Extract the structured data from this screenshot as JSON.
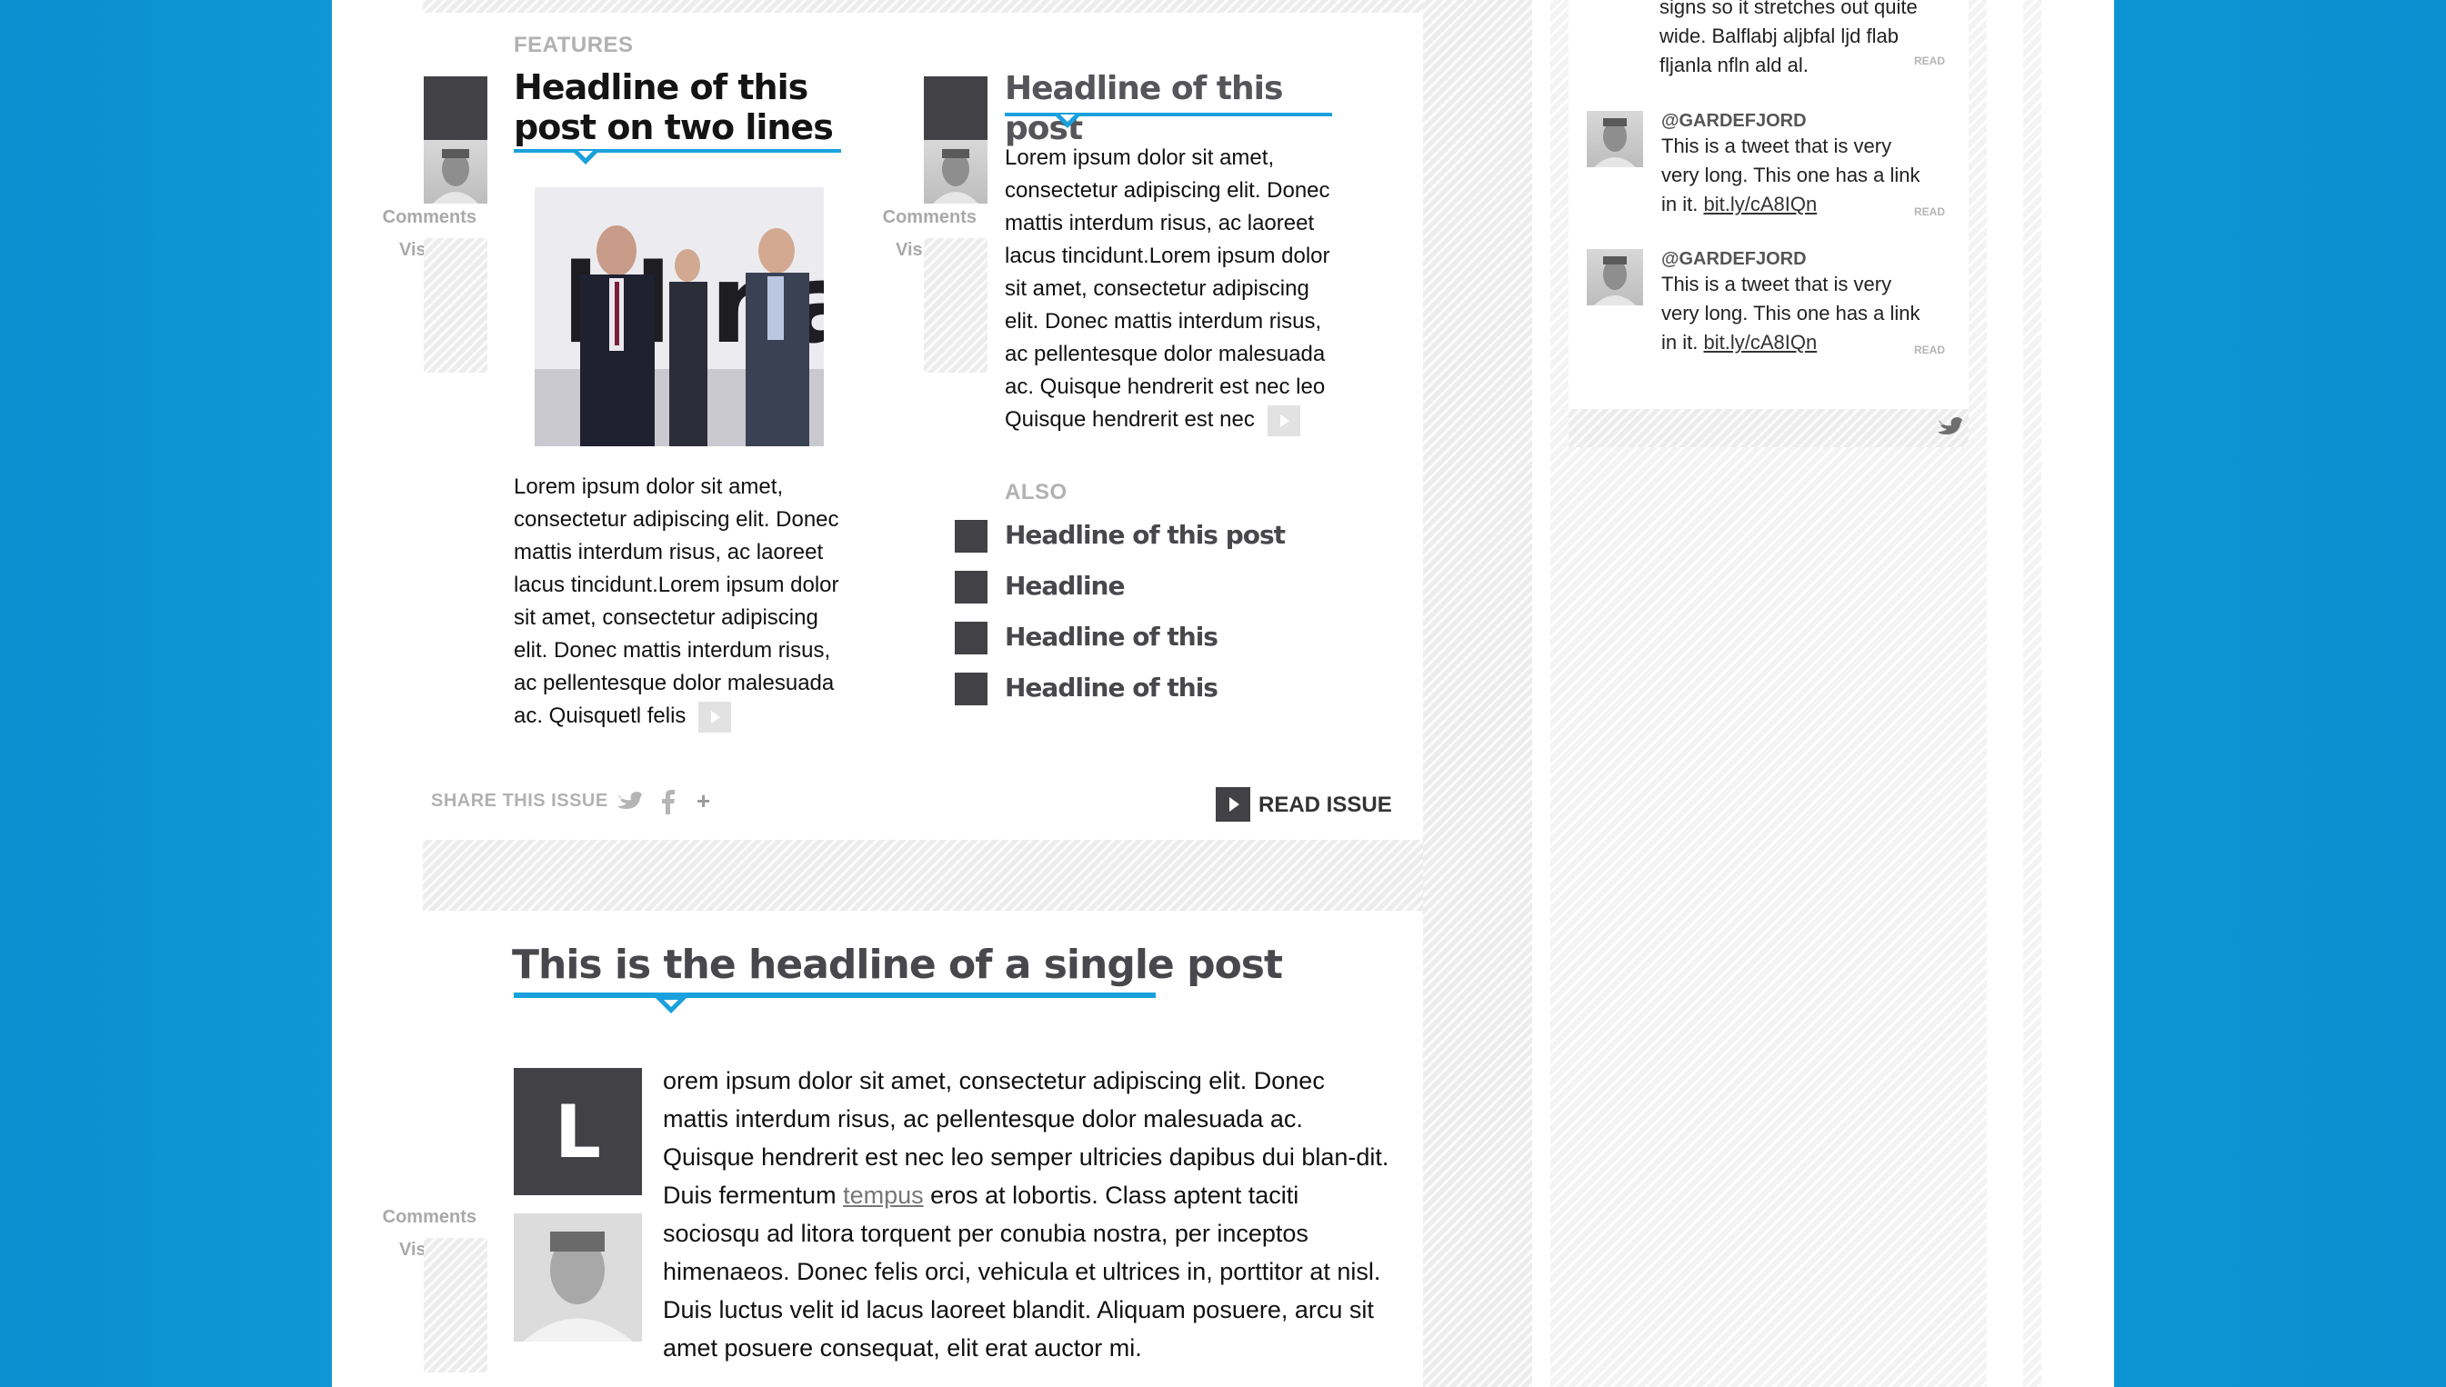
{
  "features": {
    "section_label": "FEATURES",
    "post1": {
      "headline": "Headline of this post on two lines",
      "meta_comments": "Comments",
      "meta_visits": "Visits",
      "body": "Lorem ipsum dolor sit amet, consectetur adipiscing elit. Donec mattis interdum risus, ac laoreet lacus tincidunt.Lorem ipsum dolor sit amet, consectetur adipiscing elit. Donec mattis interdum risus, ac pellentesque dolor malesuada ac. Quisquetl  felis"
    },
    "post2": {
      "headline": "Headline of this post",
      "meta_comments": "Comments",
      "meta_visits": "Visits",
      "body": "Lorem ipsum dolor sit amet, consectetur adipiscing elit. Donec mattis interdum risus, ac laoreet lacus tincidunt.Lorem ipsum dolor sit amet, consectetur adipiscing elit. Donec mattis interdum risus, ac pellentesque dolor malesuada ac. Quisque hendrerit est nec leo Quisque hendrerit est nec"
    },
    "also": {
      "label": "ALSO",
      "items": [
        "Headline of this post",
        "Headline",
        "Headline of this",
        "Headline of this"
      ]
    },
    "share": {
      "label": "SHARE THIS ISSUE",
      "plus": "+"
    },
    "read_issue": "READ ISSUE"
  },
  "single_post": {
    "headline": "This is the headline of a single post",
    "drop_cap": "L",
    "body_before_link": "orem ipsum dolor sit amet, consectetur adipiscing elit. Donec mattis interdum risus, ac pellentesque dolor malesuada ac. Quisque hendrerit est nec leo semper ultricies dapibus dui blan-dit. Duis fermentum ",
    "body_link": "tempus",
    "body_after_link": " eros at lobortis. Class aptent taciti sociosqu ad litora torquent per conubia nostra, per inceptos himenaeos. Donec felis orci, vehicula et ultrices in, porttitor at nisl. Duis luctus velit id lacus laoreet blandit. Aliquam posuere, arcu sit amet posuere consequat, elit erat auctor mi.",
    "meta_comments": "Comments",
    "meta_visits": "Visits"
  },
  "sidebar": {
    "tweets": [
      {
        "handle": "",
        "text": "signs so it stretches out quite wide. Balflabj aljbfal ljd flab fljanla nfln ald al.",
        "link": "",
        "read": "READ"
      },
      {
        "handle": "@GARDEFJORD",
        "text": "This is a tweet that is very very long. This one has a link in it. ",
        "link": "bit.ly/cA8IQn",
        "read": "READ"
      },
      {
        "handle": "@GARDEFJORD",
        "text": "This is a tweet that is very very long. This one has a link in it. ",
        "link": "bit.ly/cA8IQn",
        "read": "READ"
      }
    ]
  },
  "colors": {
    "background_blue": "#14a0dc",
    "accent_blue": "#1aa0dc",
    "dark_square": "#424246"
  }
}
